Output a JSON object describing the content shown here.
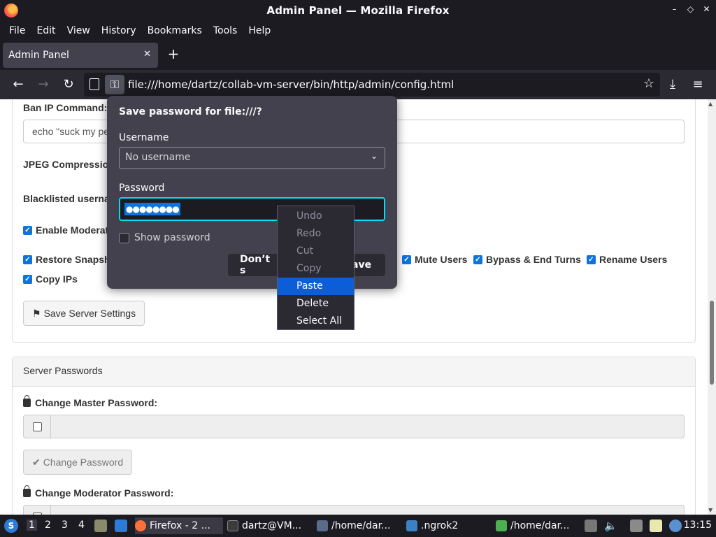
{
  "window": {
    "title": "Admin Panel — Mozilla Firefox"
  },
  "menubar": {
    "items": [
      "File",
      "Edit",
      "View",
      "History",
      "Bookmarks",
      "Tools",
      "Help"
    ]
  },
  "tabs": [
    {
      "label": "Admin Panel"
    }
  ],
  "navbar": {
    "url": "file:///home/dartz/collab-vm-server/bin/http/admin/config.html"
  },
  "page": {
    "ban_ip_label": "Ban IP Command:",
    "ban_ip_value": "echo \"suck my pe",
    "jpeg_label": "JPEG Compressio",
    "blacklisted_label": "Blacklisted userna",
    "enable_mod_label": "Enable Moderat",
    "restore_label": "Restore Snapsh",
    "mute_users_label": "Mute Users",
    "bypass_label": "Bypass & End Turns",
    "rename_label": "Rename Users",
    "copy_ips_label": "Copy IPs",
    "save_settings_label": "Save Server Settings",
    "server_passwords_heading": "Server Passwords",
    "change_master_label": "Change Master Password:",
    "change_password_label": "Change Password",
    "change_mod_label": "Change Moderator Password:"
  },
  "password_popup": {
    "title": "Save password for file:///?",
    "username_label": "Username",
    "username_placeholder": "No username",
    "password_label": "Password",
    "password_masked": "●●●●●●●●",
    "show_password_label": "Show password",
    "dont_save_label": "Don’t s",
    "save_label": "ave"
  },
  "context_menu": {
    "items": [
      {
        "label": "Undo",
        "state": "disabled"
      },
      {
        "label": "Redo",
        "state": "disabled"
      },
      {
        "label": "Cut",
        "state": "disabled"
      },
      {
        "label": "Copy",
        "state": "disabled"
      },
      {
        "label": "Paste",
        "state": "active"
      },
      {
        "label": "Delete",
        "state": "enabled"
      },
      {
        "label": "Select All",
        "state": "enabled"
      }
    ]
  },
  "taskbar": {
    "workspaces": [
      "1",
      "2",
      "3",
      "4"
    ],
    "tasks": [
      {
        "label": "Firefox - 2 ...",
        "color": "#ff7139"
      },
      {
        "label": "dartz@VM...",
        "color": "#3c3c3c"
      },
      {
        "label": "/home/dar...",
        "color": "#5a6a8a"
      },
      {
        "label": ".ngrok2",
        "color": "#3b82c4"
      },
      {
        "label": "/home/dar...",
        "color": "#4caf50"
      }
    ],
    "clock": "13:15"
  },
  "colors": {
    "accent": "#0b74de",
    "focus_ring": "#00ddff",
    "menu_highlight": "#0b5ed7"
  }
}
